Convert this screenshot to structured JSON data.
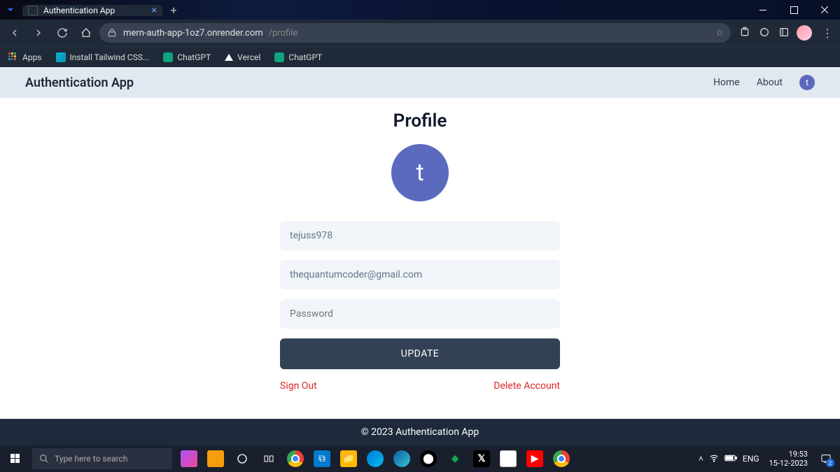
{
  "titlebar": {
    "tab_title": "Authentication App"
  },
  "addressbar": {
    "url_host": "mern-auth-app-1oz7.onrender.com",
    "url_path": "/profile"
  },
  "bookmarks": {
    "apps": "Apps",
    "tailwind": "Install Tailwind CSS...",
    "chatgpt1": "ChatGPT",
    "vercel": "Vercel",
    "chatgpt2": "ChatGPT"
  },
  "header": {
    "app_name": "Authentication App",
    "nav_home": "Home",
    "nav_about": "About",
    "user_initial": "t"
  },
  "profile": {
    "title": "Profile",
    "avatar_initial": "t",
    "username_value": "tejuss978",
    "email_value": "thequantumcoder@gmail.com",
    "password_placeholder": "Password",
    "update_button": "UPDATE",
    "signout": "Sign Out",
    "delete": "Delete Account"
  },
  "footer": {
    "copyright": "© 2023 Authentication App"
  },
  "taskbar": {
    "search_placeholder": "Type here to search",
    "lang": "ENG",
    "time": "19:53",
    "date": "15-12-2023",
    "notif_count": "2"
  }
}
